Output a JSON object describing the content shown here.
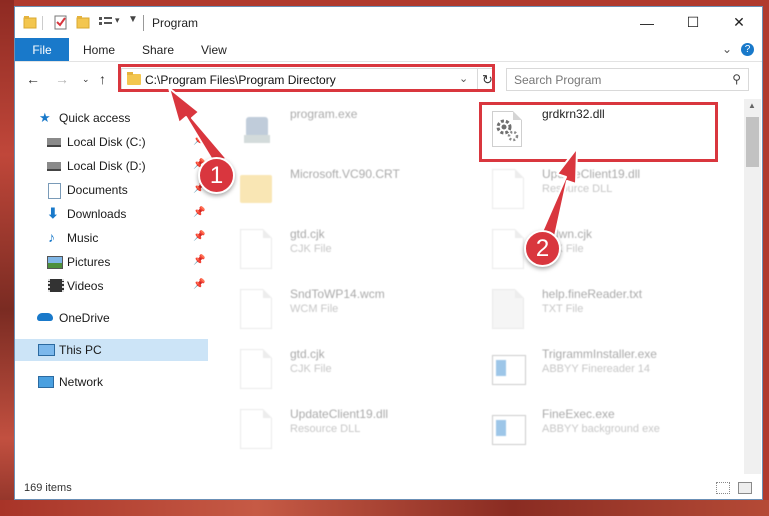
{
  "window": {
    "title": "Program",
    "controls": {
      "minimize": "—",
      "maximize": "☐",
      "close": "✕"
    }
  },
  "ribbon": {
    "tabs": [
      "File",
      "Home",
      "Share",
      "View"
    ]
  },
  "nav": {
    "address": "C:\\Program Files\\Program Directory",
    "search_placeholder": "Search Program"
  },
  "sidebar": {
    "items": [
      {
        "label": "Quick access",
        "icon": "star-icon",
        "pinned": false
      },
      {
        "label": "Local Disk (C:)",
        "icon": "drive-icon",
        "pinned": true
      },
      {
        "label": "Local Disk (D:)",
        "icon": "drive-icon",
        "pinned": true
      },
      {
        "label": "Documents",
        "icon": "documents-icon",
        "pinned": true
      },
      {
        "label": "Downloads",
        "icon": "download-icon",
        "pinned": true
      },
      {
        "label": "Music",
        "icon": "music-icon",
        "pinned": true
      },
      {
        "label": "Pictures",
        "icon": "pictures-icon",
        "pinned": true
      },
      {
        "label": "Videos",
        "icon": "videos-icon",
        "pinned": true
      },
      {
        "label": "OneDrive",
        "icon": "cloud-icon",
        "pinned": false
      },
      {
        "label": "This PC",
        "icon": "computer-icon",
        "pinned": false,
        "selected": true
      },
      {
        "label": "Network",
        "icon": "network-icon",
        "pinned": false
      }
    ]
  },
  "files": [
    {
      "name": "program.exe",
      "type": "",
      "highlighted": false
    },
    {
      "name": "grdkrn32.dll",
      "type": "",
      "highlighted": true
    },
    {
      "name": "Microsoft.VC90.CRT",
      "type": "",
      "highlighted": false
    },
    {
      "name": "UpdateClient19.dll",
      "type": "Resource DLL",
      "highlighted": false
    },
    {
      "name": "gtd.cjk",
      "type": "CJK File",
      "highlighted": false
    },
    {
      "name": "gtdwn.cjk",
      "type": "CJK File",
      "highlighted": false
    },
    {
      "name": "SndToWP14.wcm",
      "type": "WCM File",
      "highlighted": false
    },
    {
      "name": "help.fineReader.txt",
      "type": "TXT File",
      "highlighted": false
    },
    {
      "name": "gtd.cjk",
      "type": "CJK File",
      "highlighted": false
    },
    {
      "name": "TrigrammInstaller.exe",
      "type": "ABBYY Finereader 14",
      "highlighted": false
    },
    {
      "name": "UpdateClient19.dll",
      "type": "Resource DLL",
      "highlighted": false
    },
    {
      "name": "FineExec.exe",
      "type": "ABBYY background exe",
      "highlighted": false
    }
  ],
  "status": {
    "items": "169 items"
  },
  "annotations": {
    "step1": "1",
    "step2": "2",
    "color": "#d9363e"
  }
}
